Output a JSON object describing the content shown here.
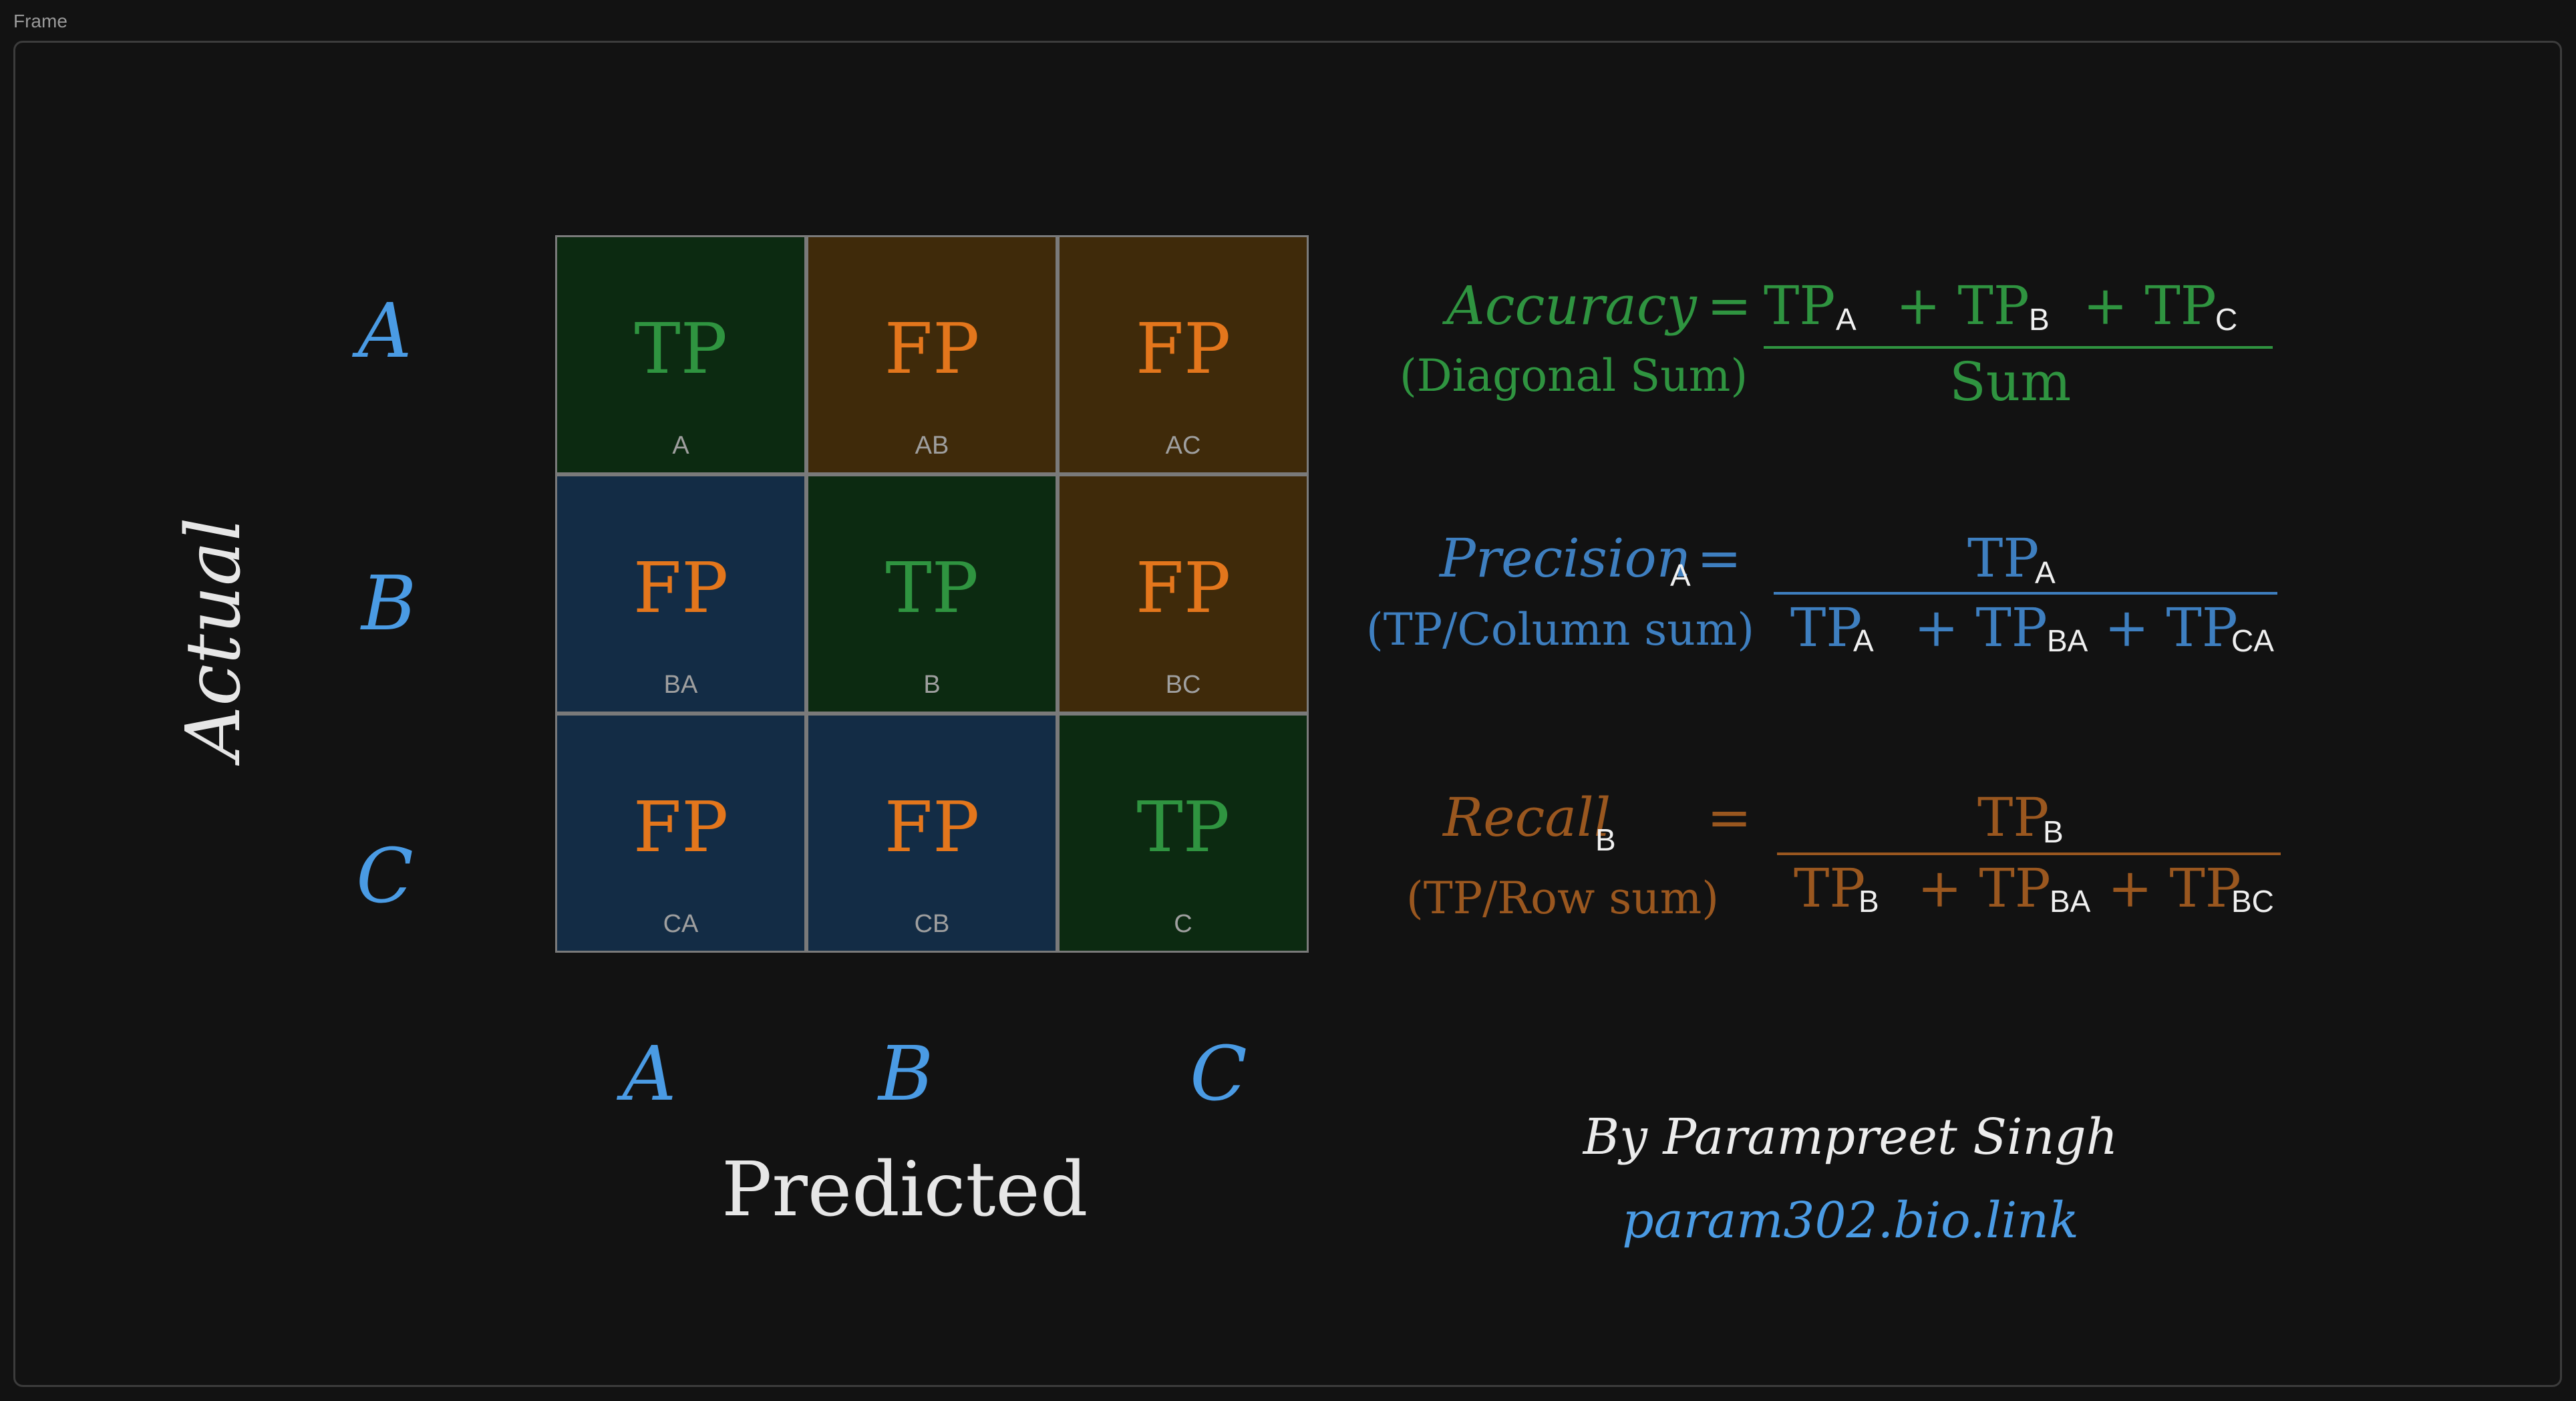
{
  "frame_label": "Frame",
  "axes": {
    "actual_title": "Actual",
    "predicted_title": "Predicted",
    "row_labels": [
      "A",
      "B",
      "C"
    ],
    "col_labels": [
      "A",
      "B",
      "C"
    ]
  },
  "matrix": {
    "rows": [
      [
        {
          "main": "TP",
          "sub": "A"
        },
        {
          "main": "FP",
          "sub": "AB"
        },
        {
          "main": "FP",
          "sub": "AC"
        }
      ],
      [
        {
          "main": "FP",
          "sub": "BA"
        },
        {
          "main": "TP",
          "sub": "B"
        },
        {
          "main": "FP",
          "sub": "BC"
        }
      ],
      [
        {
          "main": "FP",
          "sub": "CA"
        },
        {
          "main": "FP",
          "sub": "CB"
        },
        {
          "main": "TP",
          "sub": "C"
        }
      ]
    ]
  },
  "formulas": {
    "accuracy": {
      "label": "Accuracy",
      "equals": "=",
      "note": "(Diagonal Sum)",
      "numerator": [
        "TP",
        "A",
        "+ TP",
        "B",
        "+ TP",
        "C"
      ],
      "denominator": "Sum"
    },
    "precision": {
      "label": "Precision",
      "label_index": "A",
      "equals": "=",
      "note": "(TP/Column sum)",
      "numerator": [
        "TP",
        "A"
      ],
      "denominator": [
        "TP",
        "A",
        "+ TP",
        "BA",
        "+ TP",
        "CA"
      ]
    },
    "recall": {
      "label": "Recall",
      "label_index": "B",
      "equals": "=",
      "note": "(TP/Row sum)",
      "numerator": [
        "TP",
        "B"
      ],
      "denominator": [
        "TP",
        "B",
        "+ TP",
        "BA",
        "+ TP",
        "BC"
      ]
    }
  },
  "credit": {
    "author": "By Parampreet Singh",
    "link": "param302.bio.link"
  },
  "colors": {
    "background": "#121212",
    "tp_cell": "#0c2a11",
    "fp_upper_cell": "#3f2a0a",
    "fp_lower_cell": "#132c45",
    "accuracy": "#2f9440",
    "precision": "#3e7fc0",
    "recall": "#9a571f",
    "axis_letters": "#4a9be4"
  }
}
